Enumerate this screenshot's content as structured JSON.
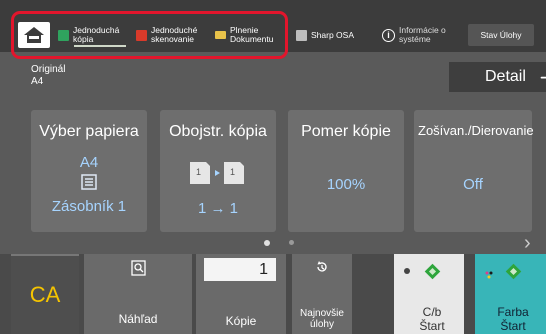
{
  "top_tabs": [
    {
      "label": "Jednoduchá kópia",
      "icon": "copy-icon"
    },
    {
      "label": "Jednoduché skenovanie",
      "icon": "scan-icon"
    },
    {
      "label": "Plnenie Dokumentu",
      "icon": "folder-icon"
    },
    {
      "label": "Sharp OSA",
      "icon": "osa-icon"
    },
    {
      "label": "Informácie o systéme",
      "icon": "info-icon"
    },
    {
      "label": "Stav Úlohy",
      "icon": ""
    }
  ],
  "original": {
    "label": "Originál",
    "value": "A4"
  },
  "detail_label": "Detail",
  "tiles": [
    {
      "title": "Výber papiera",
      "value1": "A4",
      "value2": "Zásobník 1"
    },
    {
      "title": "Obojstr. kópia",
      "value": "1 → 1"
    },
    {
      "title": "Pomer kópie",
      "value": "100%"
    },
    {
      "title": "Zošívan./Dierovanie",
      "value": "Off"
    }
  ],
  "pager": {
    "active": 0,
    "count": 2
  },
  "bottom": {
    "ca_label": "CA",
    "preview_label": "Náhľad",
    "copies_label": "Kópie",
    "copies_value": "1",
    "recent_jobs_label": "Najnovšie úlohy",
    "bw_start_line1": "C/b",
    "bw_start_line2": "Štart",
    "color_start_line1": "Farba",
    "color_start_line2": "Štart"
  },
  "colors": {
    "accent_highlight": "#e2152c",
    "tile_value_blue": "#a6d4ff",
    "color_start": "#38b5b8",
    "ca_yellow": "#f5c400"
  }
}
